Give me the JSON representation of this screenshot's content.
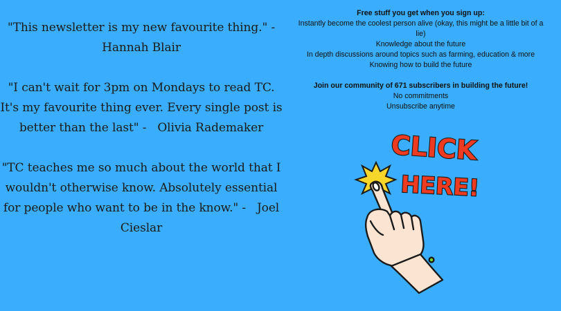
{
  "testimonials": [
    {
      "quote": "\"This newsletter is my new favourite thing.\" -",
      "author": "Hannah Blair"
    },
    {
      "quote": "\"I can't wait for 3pm on Mondays to read TC. It's my favourite thing ever. Every single post is better than the last\" -",
      "author": "Olivia Rademaker"
    },
    {
      "quote": "\"TC teaches me so much about the world that I wouldn't otherwise know. Absolutely essential for people who want to be in the know.\" -",
      "author": "Joel Cieslar"
    }
  ],
  "signup": {
    "heading": "Free stuff you get when you sign up:",
    "benefits": [
      "Instantly become the coolest person alive (okay, this might be a little bit of a lie)",
      "Knowledge about the future",
      "In depth discussions around topics such as farming, education & more",
      "Knowing how to build the future"
    ],
    "community": "Join our community of 671 subscribers in building the future!",
    "terms": [
      "No commitments",
      "Unsubscribe anytime"
    ]
  },
  "cta": {
    "line1": "CLICK",
    "line2": "HERE!",
    "icon": "pointing-hand-icon"
  },
  "colors": {
    "background": "#3aaefc",
    "cta_text_fill": "#ec3b20",
    "cta_text_stroke": "#1a1a1a",
    "cta_burst": "#f6d62a",
    "cta_hand": "#fbe4d2"
  }
}
